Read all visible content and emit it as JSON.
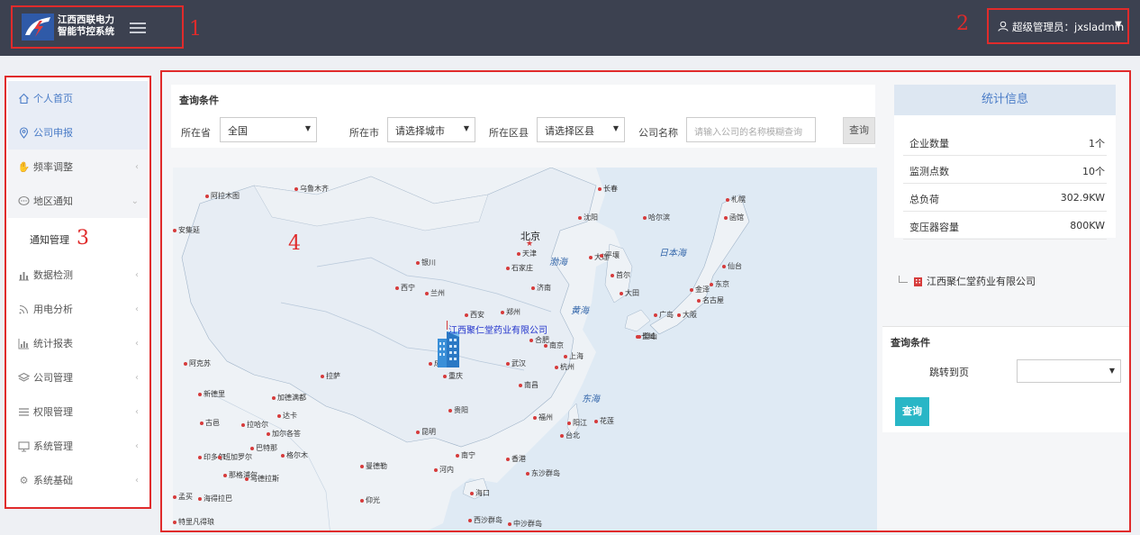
{
  "header": {
    "logo_line1": "江西西联电力",
    "logo_line2": "智能节控系统",
    "user_label": "超级管理员：jxsladmin",
    "brand_color": "#3c4150",
    "annotation_color": "#e02b2b"
  },
  "annotations": {
    "a1": "1",
    "a2": "2",
    "a3": "3",
    "a4": "4"
  },
  "sidebar": {
    "items": [
      {
        "label": "个人首页",
        "icon": "home-icon"
      },
      {
        "label": "公司申报",
        "icon": "location-pin-icon"
      },
      {
        "label": "频率调整",
        "icon": "hand-icon"
      },
      {
        "label": "地区通知",
        "icon": "chat-bubble-icon"
      },
      {
        "label": "数据检测",
        "icon": "bar-chart-icon"
      },
      {
        "label": "用电分析",
        "icon": "signal-icon"
      },
      {
        "label": "统计报表",
        "icon": "report-chart-icon"
      },
      {
        "label": "公司管理",
        "icon": "layers-icon"
      },
      {
        "label": "权限管理",
        "icon": "list-icon"
      },
      {
        "label": "系统管理",
        "icon": "monitor-icon"
      },
      {
        "label": "系统基础",
        "icon": "gear-icon"
      }
    ],
    "sub_items": [
      "通知管理"
    ]
  },
  "query": {
    "title": "查询条件",
    "province_label": "所在省",
    "province_value": "全国",
    "city_label": "所在市",
    "city_value": "请选择城市",
    "district_label": "所在区县",
    "district_value": "请选择区县",
    "company_label": "公司名称",
    "company_placeholder": "请输入公司的名称模糊查询",
    "button": "查询"
  },
  "map": {
    "marker_label": "江西聚仁堂药业有限公司",
    "capital_label": "北京",
    "cities": [
      "乌鲁木齐",
      "阿拉木图",
      "安集延",
      "银川",
      "西宁",
      "兰州",
      "西安",
      "郑州",
      "石家庄",
      "天津",
      "济南",
      "成都",
      "重庆",
      "武汉",
      "合肥",
      "南京",
      "上海",
      "杭州",
      "南昌",
      "福州",
      "贵阳",
      "昆明",
      "南宁",
      "海口",
      "香港",
      "河内",
      "拉萨",
      "加德满都",
      "新德里",
      "大连",
      "沈阳",
      "长春",
      "哈尔滨",
      "平壤",
      "首尔",
      "釜山",
      "东京",
      "大阪",
      "广岛",
      "长崎",
      "札幌",
      "函馆",
      "仙台",
      "金泽",
      "名古屋",
      "台北",
      "花莲",
      "大田",
      "阳江",
      "曼德勒",
      "仰光",
      "加尔各答",
      "达卡",
      "海得拉巴",
      "那格浦尔",
      "孟买",
      "印多尔",
      "特里凡得琅",
      "西沙群岛",
      "中沙群岛",
      "东沙群岛",
      "马德拉斯",
      "班加罗尔",
      "古邑",
      "拉哈尔",
      "巴特那",
      "格尔木",
      "阿克苏"
    ],
    "seas": [
      "渤海",
      "黄海",
      "东海",
      "日本海"
    ]
  },
  "stats": {
    "title": "统计信息",
    "rows": [
      {
        "label": "企业数量",
        "value": "1个"
      },
      {
        "label": "监测点数",
        "value": "10个"
      },
      {
        "label": "总负荷",
        "value": "302.9KW"
      },
      {
        "label": "变压器容量",
        "value": "800KW"
      }
    ]
  },
  "tree": {
    "company": "江西聚仁堂药业有限公司"
  },
  "query2": {
    "title": "查询条件",
    "jump_label": "跳转到页",
    "jump_value": "",
    "button": "查询",
    "button_color": "#29b6c6"
  }
}
